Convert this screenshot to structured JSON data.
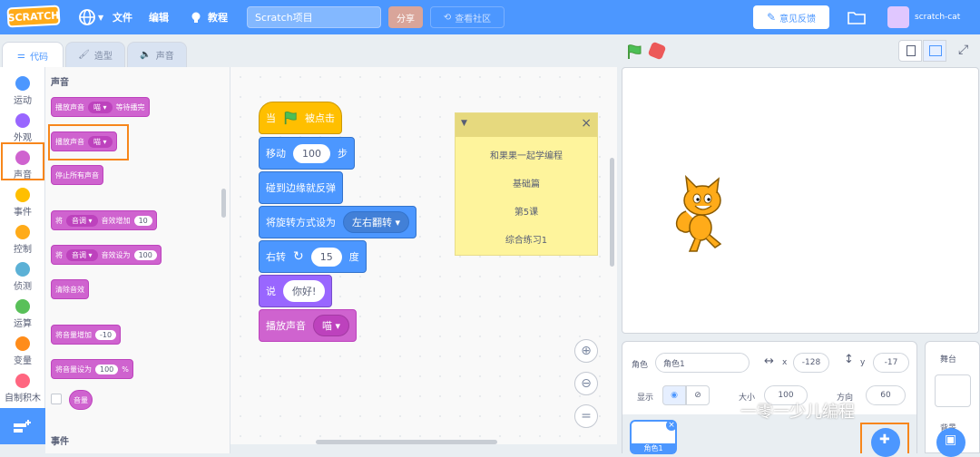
{
  "menubar": {
    "logo_text": "SCRATCH",
    "file_label": "文件",
    "edit_label": "编辑",
    "tutorial_label": "教程",
    "project_title": "Scratch项目",
    "share_label": "分享",
    "community_label": "查看社区",
    "feedback_label": "意见反馈",
    "username": "scratch-cat"
  },
  "tabs": [
    {
      "label": "代码",
      "icon": "code-icon"
    },
    {
      "label": "造型",
      "icon": "brush-icon"
    },
    {
      "label": "声音",
      "icon": "speaker-icon"
    }
  ],
  "categories": [
    {
      "label": "运动",
      "color": "#4c97ff"
    },
    {
      "label": "外观",
      "color": "#9966ff"
    },
    {
      "label": "声音",
      "color": "#cf63cf"
    },
    {
      "label": "事件",
      "color": "#ffbf00"
    },
    {
      "label": "控制",
      "color": "#ffab19"
    },
    {
      "label": "侦测",
      "color": "#5cb1d6"
    },
    {
      "label": "运算",
      "color": "#59c059"
    },
    {
      "label": "变量",
      "color": "#ff8c1a"
    },
    {
      "label": "自制积木",
      "color": "#ff6680"
    }
  ],
  "palette": {
    "heading": "声音",
    "footer_heading": "事件",
    "blocks": {
      "play_until_done": {
        "pre": "播放声音",
        "dd": "喵",
        "post": "等待播完"
      },
      "start_sound": {
        "pre": "播放声音",
        "dd": "喵"
      },
      "stop_all": "停止所有声音",
      "change_effect": {
        "pre": "将",
        "dd": "音调",
        "mid": "音效增加",
        "num": "10"
      },
      "set_effect": {
        "pre": "将",
        "dd": "音调",
        "mid": "音效设为",
        "num": "100"
      },
      "clear_effects": "清除音效",
      "change_volume": {
        "pre": "将音量增加",
        "num": "-10"
      },
      "set_volume": {
        "pre": "将音量设为",
        "num": "100",
        "post": "%"
      },
      "volume_reporter": "音量"
    }
  },
  "script": {
    "hat": {
      "pre": "当",
      "post": "被点击"
    },
    "move": {
      "pre": "移动",
      "num": "100",
      "post": "步"
    },
    "bounce": "碰到边缘就反弹",
    "rotation": {
      "pre": "将旋转方式设为",
      "dd": "左右翻转"
    },
    "turn": {
      "pre": "右转",
      "num": "15",
      "post": "度"
    },
    "say": {
      "pre": "说",
      "text": "你好!"
    },
    "sound": {
      "pre": "播放声音",
      "dd": "喵"
    }
  },
  "note": {
    "lines": [
      "和果果一起学编程",
      "基础篇",
      "第5课",
      "综合练习1"
    ]
  },
  "sprite_info": {
    "sprite_label": "角色",
    "sprite_name": "角色1",
    "x_label": "x",
    "x_value": "-128",
    "y_label": "y",
    "y_value": "-17",
    "show_label": "显示",
    "size_label": "大小",
    "size_value": "100",
    "direction_label": "方向",
    "direction_value": "60",
    "thumbnail_label": "角色1"
  },
  "stage_panel": {
    "title": "舞台",
    "backdrop_label": "背景"
  },
  "watermark": "一零一少儿编程"
}
